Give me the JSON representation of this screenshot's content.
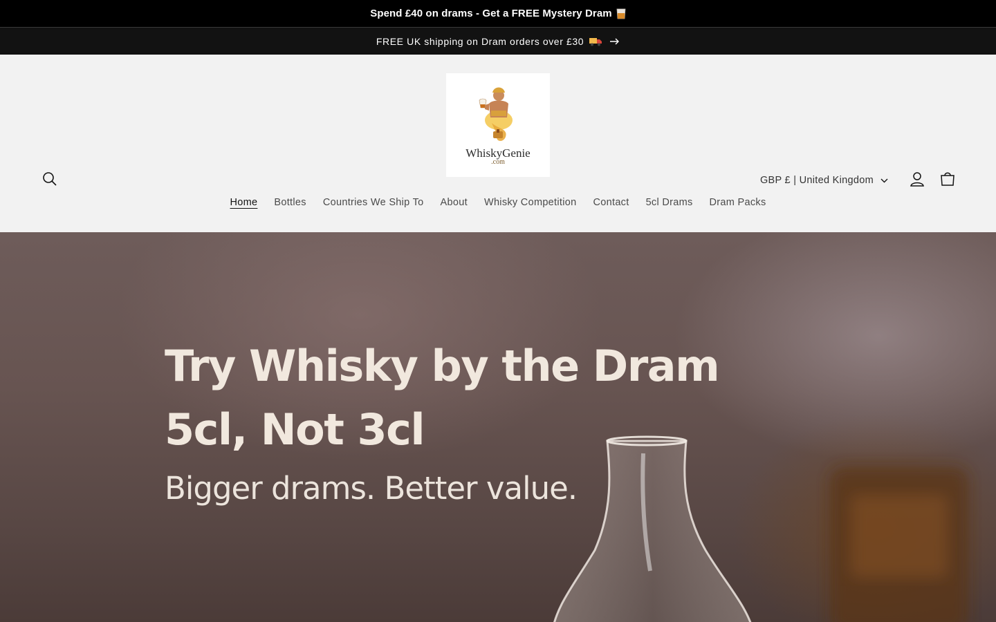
{
  "promo": {
    "text": "Spend £40 on drams - Get a FREE Mystery Dram",
    "icon": "whisky-glass-emoji"
  },
  "shipping": {
    "text": "FREE UK shipping on Dram orders over £30",
    "icons": [
      "truck-emoji",
      "arrow-right-icon"
    ]
  },
  "header": {
    "logo": {
      "name": "WhiskyGenie",
      "sub": ".com"
    },
    "locale": "GBP £ | United Kingdom",
    "icons": [
      "search-icon",
      "account-icon",
      "cart-icon"
    ]
  },
  "nav": {
    "items": [
      "Home",
      "Bottles",
      "Countries We Ship To",
      "About",
      "Whisky Competition",
      "Contact",
      "5cl Drams",
      "Dram Packs"
    ],
    "active": "Home"
  },
  "hero": {
    "title_line1": "Try Whisky by the Dram",
    "title_line2": "5cl, Not 3cl",
    "subtitle": "Bigger drams. Better value."
  },
  "colors": {
    "announcement_bg": "#000000",
    "header_bg": "#f2f2f2",
    "hero_text": "#f1e8de"
  }
}
